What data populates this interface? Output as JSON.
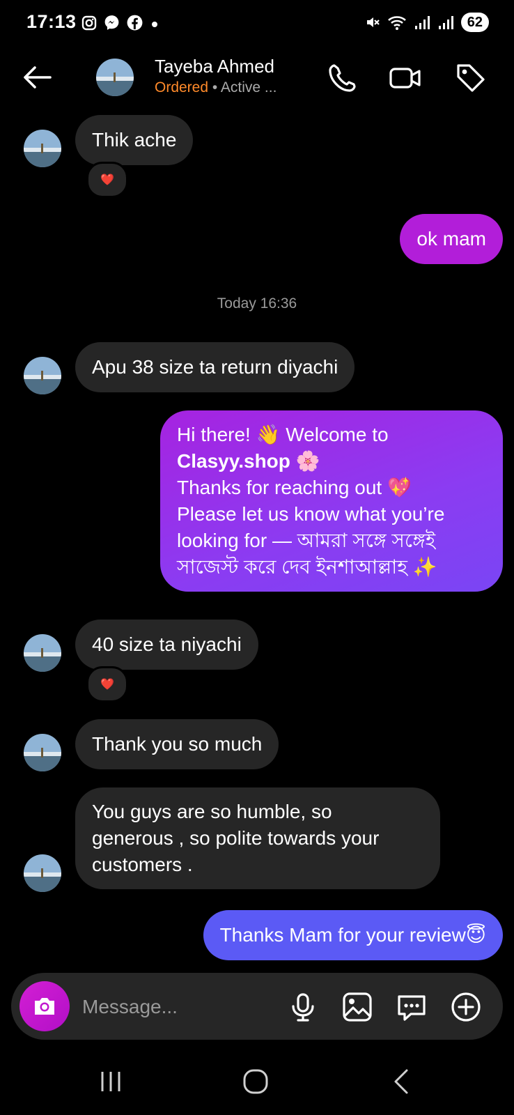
{
  "status_bar": {
    "time": "17:13",
    "battery": "62",
    "left_icons": [
      "instagram-icon",
      "messenger-icon",
      "facebook-icon",
      "dot-icon"
    ],
    "right_icons": [
      "mute-icon",
      "wifi-icon",
      "signal-icon",
      "signal-icon"
    ]
  },
  "header": {
    "name": "Tayeba Ahmed",
    "label": "Ordered",
    "status": " • Active ..."
  },
  "messages": {
    "m1": "Thik ache",
    "m2": "ok mam",
    "timestamp": "Today 16:36",
    "m3": "Apu 38 size ta return diyachi",
    "m4_l1a": "Hi there! ",
    "m4_l1_emoji": "👋",
    "m4_l1b": " Welcome to",
    "m4_l2": "Clasyy.shop",
    "m4_l2_emoji": "🌸",
    "m4_l3": "Thanks for reaching out ",
    "m4_l3_emoji": "💖",
    "m4_l4": "Please let us know what you’re",
    "m4_l5": "looking for — আমরা সঙ্গে সঙ্গেই",
    "m4_l6": "সাজেস্ট করে দেব ইনশাআল্লাহ ",
    "m4_l6_emoji": "✨",
    "m5": "40 size ta niyachi",
    "m6": "Thank you so much",
    "m7_l1": "You guys are so humble, so",
    "m7_l2": "generous , so polite towards your",
    "m7_l3": "customers .",
    "m8": "Thanks Mam for your review",
    "m8_emoji": "😇",
    "reaction": "❤️"
  },
  "composer": {
    "placeholder": "Message..."
  },
  "colors": {
    "incoming_bubble": "#262626",
    "outgoing_purple": "#b21ed9",
    "outgoing_violet": "#8b3cf2",
    "outgoing_blue": "#5b5af5",
    "ordered_label": "#ff8a2a"
  }
}
